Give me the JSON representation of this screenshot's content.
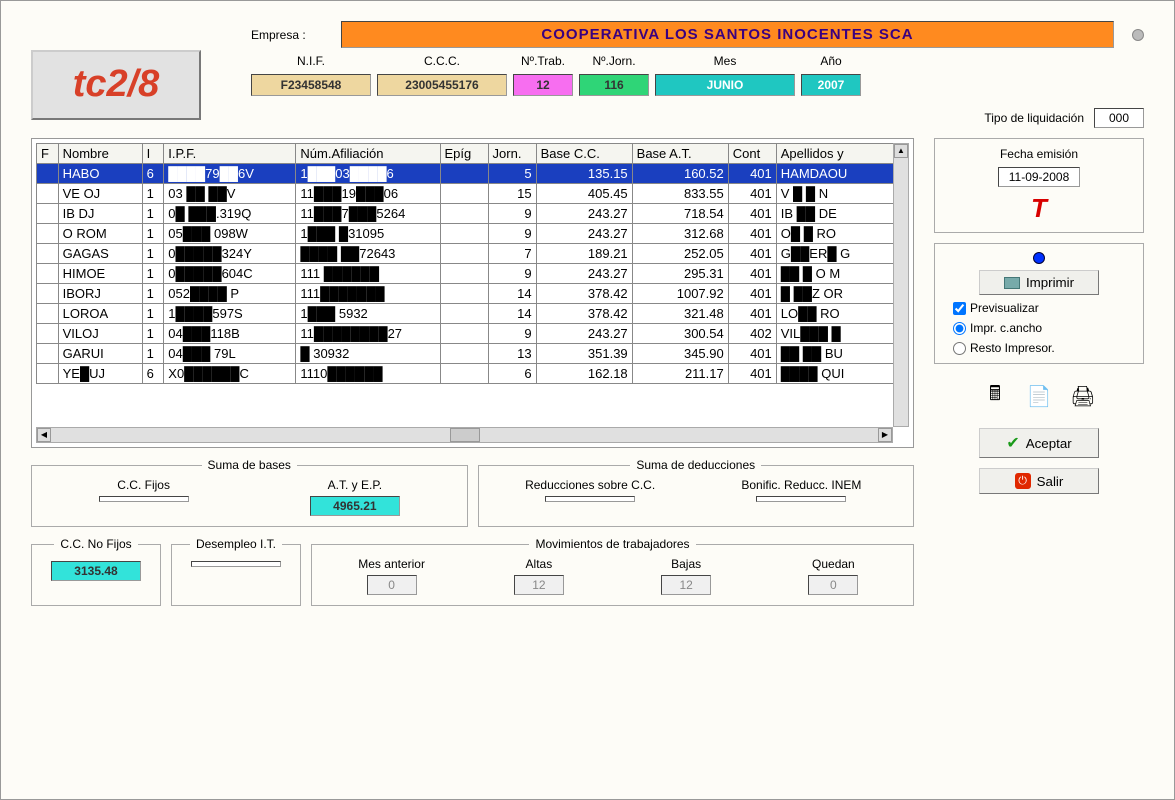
{
  "logo": "tc2/8",
  "header": {
    "empresa_label": "Empresa :",
    "empresa_value": "COOPERATIVA LOS SANTOS INOCENTES SCA",
    "cols": {
      "nif_label": "N.I.F.",
      "ccc_label": "C.C.C.",
      "trab_label": "Nº.Trab.",
      "jorn_label": "Nº.Jorn.",
      "mes_label": "Mes",
      "ano_label": "Año",
      "nif": "F23458548",
      "ccc": "23005455176",
      "trab": "12",
      "jorn": "116",
      "mes": "JUNIO",
      "ano": "2007"
    },
    "tipo_label": "Tipo de liquidación",
    "tipo_value": "000"
  },
  "grid": {
    "headers": [
      "F",
      "Nombre",
      "I",
      "I.P.F.",
      "Núm.Afiliación",
      "Epíg",
      "Jorn.",
      "Base C.C.",
      "Base A.T.",
      "Cont",
      "Apellidos y"
    ],
    "rows": [
      {
        "sel": true,
        "f": "",
        "nom": "HABO",
        "i": "6",
        "ipf": "████79██6V",
        "afi": "1███03████6",
        "epi": "",
        "jor": "5",
        "bcc": "135.15",
        "bat": "160.52",
        "con": "401",
        "ape": "HAMDAOU"
      },
      {
        "f": "",
        "nom": "VE  OJ",
        "i": "1",
        "ipf": "03  ██  ██V",
        "afi": "11███19███06",
        "epi": "",
        "jor": "15",
        "bcc": "405.45",
        "bat": "833.55",
        "con": "401",
        "ape": "V █  █ N"
      },
      {
        "f": "",
        "nom": "IB DJ",
        "i": "1",
        "ipf": "0█ ███.319Q",
        "afi": "11███7███5264",
        "epi": "",
        "jor": "9",
        "bcc": "243.27",
        "bat": "718.54",
        "con": "401",
        "ape": "IB ██ DE"
      },
      {
        "f": "",
        "nom": "O ROM",
        "i": "1",
        "ipf": "05███ 098W",
        "afi": "1███ █31095",
        "epi": "",
        "jor": "9",
        "bcc": "243.27",
        "bat": "312.68",
        "con": "401",
        "ape": "O█ █ RO"
      },
      {
        "f": "",
        "nom": "GAGAS",
        "i": "1",
        "ipf": "0█████324Y",
        "afi": "████ ██72643",
        "epi": "",
        "jor": "7",
        "bcc": "189.21",
        "bat": "252.05",
        "con": "401",
        "ape": "G██ER█ G"
      },
      {
        "f": "",
        "nom": "HIMOE",
        "i": "1",
        "ipf": "0█████604C",
        "afi": "111 ██████",
        "epi": "",
        "jor": "9",
        "bcc": "243.27",
        "bat": "295.31",
        "con": "401",
        "ape": "██ █ O M"
      },
      {
        "f": "",
        "nom": "IBORJ",
        "i": "1",
        "ipf": "052████  P",
        "afi": "111███████",
        "epi": "",
        "jor": "14",
        "bcc": "378.42",
        "bat": "1007.92",
        "con": "401",
        "ape": "█ ██Z OR"
      },
      {
        "f": "",
        "nom": "LOROA",
        "i": "1",
        "ipf": "1████597S",
        "afi": "1███ 5932",
        "epi": "",
        "jor": "14",
        "bcc": "378.42",
        "bat": "321.48",
        "con": "401",
        "ape": "LO██ RO"
      },
      {
        "f": "",
        "nom": "VILOJ",
        "i": "1",
        "ipf": "04███118B",
        "afi": "11████████27",
        "epi": "",
        "jor": "9",
        "bcc": "243.27",
        "bat": "300.54",
        "con": "402",
        "ape": "VIL███ █"
      },
      {
        "f": "",
        "nom": "GARUI",
        "i": "1",
        "ipf": "04███ 79L",
        "afi": "█     30932",
        "epi": "",
        "jor": "13",
        "bcc": "351.39",
        "bat": "345.90",
        "con": "401",
        "ape": "██ ██ BU"
      },
      {
        "f": "",
        "nom": "YE█UJ",
        "i": "6",
        "ipf": "X0██████C",
        "afi": "1110██████",
        "epi": "",
        "jor": "6",
        "bcc": "162.18",
        "bat": "211.17",
        "con": "401",
        "ape": "████ QUI"
      }
    ]
  },
  "sums": {
    "bases_title": "Suma de bases",
    "cc_fijos_label": "C.C. Fijos",
    "cc_fijos": "",
    "at_label": "A.T. y E.P.",
    "at": "4965.21",
    "cc_nofijos_label": "C.C. No Fijos",
    "cc_nofijos": "3135.48",
    "desem_label": "Desempleo I.T.",
    "desem": "",
    "ded_title": "Suma de deducciones",
    "red_cc_label": "Reducciones sobre C.C.",
    "red_cc": "",
    "bonif_label": "Bonific. Reducc. INEM",
    "bonif": "",
    "mov_title": "Movimientos de trabajadores",
    "mes_ant_label": "Mes anterior",
    "mes_ant": "0",
    "altas_label": "Altas",
    "altas": "12",
    "bajas_label": "Bajas",
    "bajas": "12",
    "quedan_label": "Quedan",
    "quedan": "0"
  },
  "side": {
    "fecha_label": "Fecha emisión",
    "fecha": "11-09-2008",
    "imprimir": "Imprimir",
    "previsualizar": "Previsualizar",
    "impr_ancho": "Impr. c.ancho",
    "resto_impr": "Resto Impresor.",
    "aceptar": "Aceptar",
    "salir": "Salir"
  }
}
